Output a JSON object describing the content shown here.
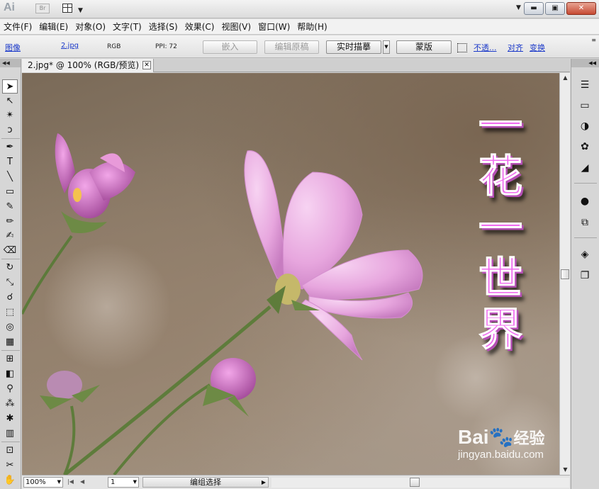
{
  "titlebar": {
    "app_logo": "Ai",
    "bridge_label": "Br",
    "window_minimize": "▬",
    "window_restore": "▣",
    "window_close": "✕"
  },
  "menubar": {
    "items": [
      "文件(F)",
      "编辑(E)",
      "对象(O)",
      "文字(T)",
      "选择(S)",
      "效果(C)",
      "视图(V)",
      "窗口(W)",
      "帮助(H)"
    ]
  },
  "controlbar": {
    "object_type": "图像",
    "file_link": "2.jpg",
    "color_mode": "RGB",
    "ppi": "PPI: 72",
    "embed_label": "嵌入",
    "edit_original_label": "编辑原稿",
    "live_trace_label": "实时描摹",
    "mask_label": "蒙版",
    "opacity_link": "不透...",
    "align_link": "对齐",
    "transform_link": "变换"
  },
  "document": {
    "tab_title": "2.jpg* @ 100% (RGB/预览)",
    "tab_close": "✕"
  },
  "artwork": {
    "vertical_text": [
      "一",
      "花",
      "一",
      "世",
      "界"
    ],
    "text_color": "#f06df0",
    "watermark_logo": "Bai",
    "watermark_logo_suffix": "经验",
    "watermark_url": "jingyan.baidu.com"
  },
  "statusbar": {
    "zoom": "100%",
    "page": "1",
    "status": "编组选择"
  }
}
